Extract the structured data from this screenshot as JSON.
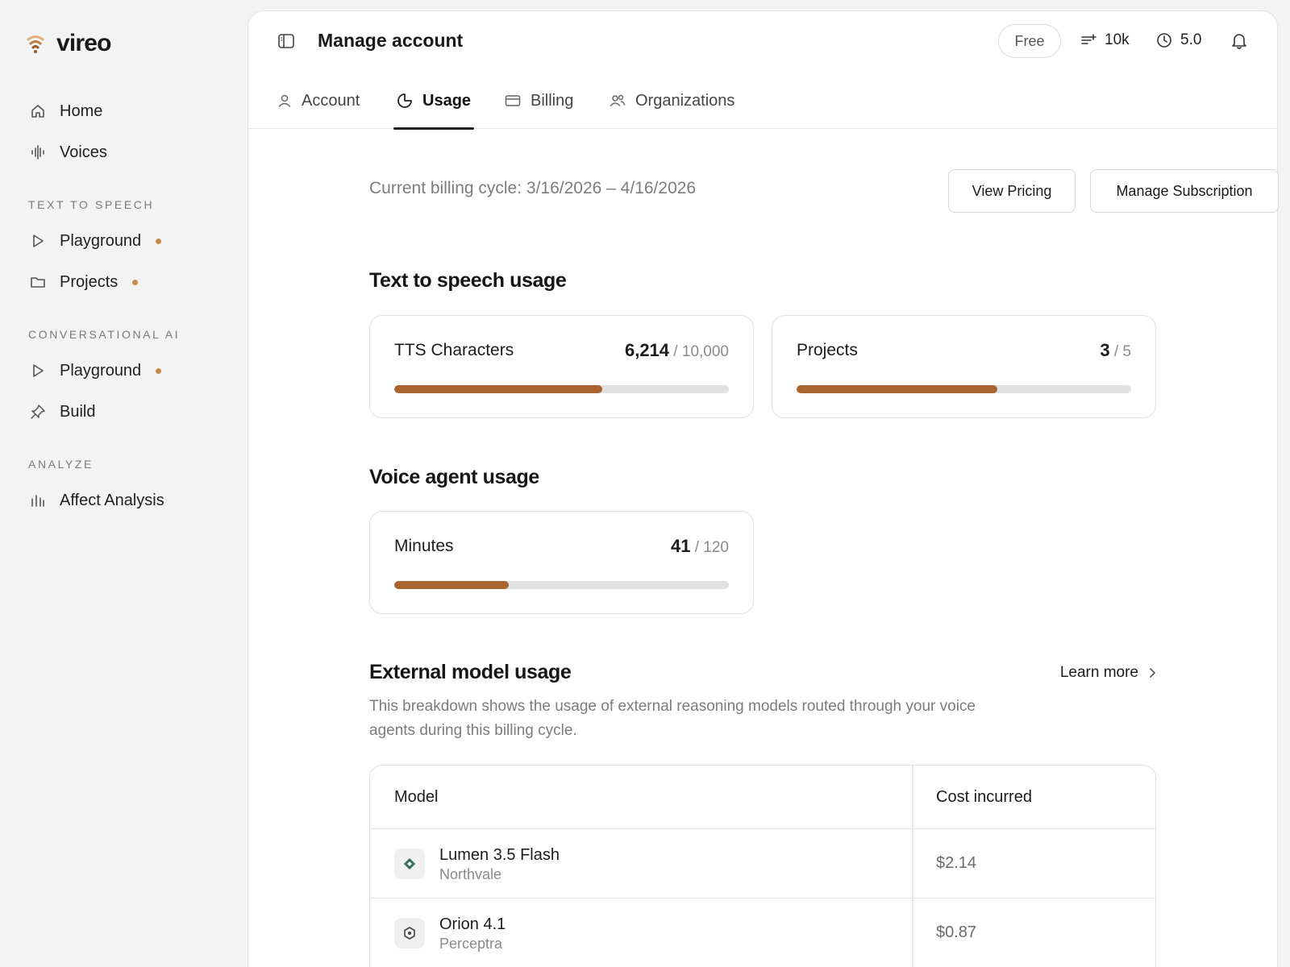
{
  "brand": {
    "name": "vireo"
  },
  "colors": {
    "accent": "#a8652f",
    "dot": "#c98a4b",
    "track": "#e1e1e1"
  },
  "sidebar": {
    "top_items": [
      {
        "label": "Home",
        "icon": "home-icon"
      },
      {
        "label": "Voices",
        "icon": "waveform-icon"
      }
    ],
    "sections": [
      {
        "label": "TEXT TO SPEECH",
        "items": [
          {
            "label": "Playground",
            "icon": "play-icon",
            "dot": true
          },
          {
            "label": "Projects",
            "icon": "folder-icon",
            "dot": true
          }
        ]
      },
      {
        "label": "CONVERSATIONAL AI",
        "items": [
          {
            "label": "Playground",
            "icon": "play-icon",
            "dot": true
          },
          {
            "label": "Build",
            "icon": "pin-icon",
            "dot": false
          }
        ]
      },
      {
        "label": "ANALYZE",
        "items": [
          {
            "label": "Affect Analysis",
            "icon": "bars-icon",
            "dot": false
          }
        ]
      }
    ]
  },
  "header": {
    "title": "Manage account",
    "plan": "Free",
    "credits": "10k",
    "concurrency": "5.0"
  },
  "tabs": [
    {
      "label": "Account",
      "icon": "user-icon",
      "active": false
    },
    {
      "label": "Usage",
      "icon": "pie-icon",
      "active": true
    },
    {
      "label": "Billing",
      "icon": "card-icon",
      "active": false
    },
    {
      "label": "Organizations",
      "icon": "users-icon",
      "active": false
    }
  ],
  "usage": {
    "billing_cycle": "Current billing cycle: 3/16/2026 – 4/16/2026",
    "view_pricing": "View Pricing",
    "manage_subscription": "Manage Subscription",
    "tts_title": "Text to speech usage",
    "tts_chars": {
      "label": "TTS Characters",
      "used": "6,214",
      "limit": "10,000",
      "fraction": 0.6214
    },
    "projects": {
      "label": "Projects",
      "used": "3",
      "limit": "5",
      "fraction": 0.6
    },
    "voice_title": "Voice agent usage",
    "minutes": {
      "label": "Minutes",
      "used": "41",
      "limit": "120",
      "fraction": 0.3417
    },
    "external_title": "External model usage",
    "learn_more": "Learn more",
    "description": "This breakdown shows the usage of external reasoning models routed through your voice agents during this billing cycle.",
    "table": {
      "columns": [
        "Model",
        "Cost incurred"
      ],
      "rows": [
        {
          "model": "Lumen 3.5 Flash",
          "vendor": "Northvale",
          "cost": "$2.14",
          "icon": "diamond-icon"
        },
        {
          "model": "Orion 4.1",
          "vendor": "Perceptra",
          "cost": "$0.87",
          "icon": "hexagon-icon"
        }
      ]
    }
  }
}
